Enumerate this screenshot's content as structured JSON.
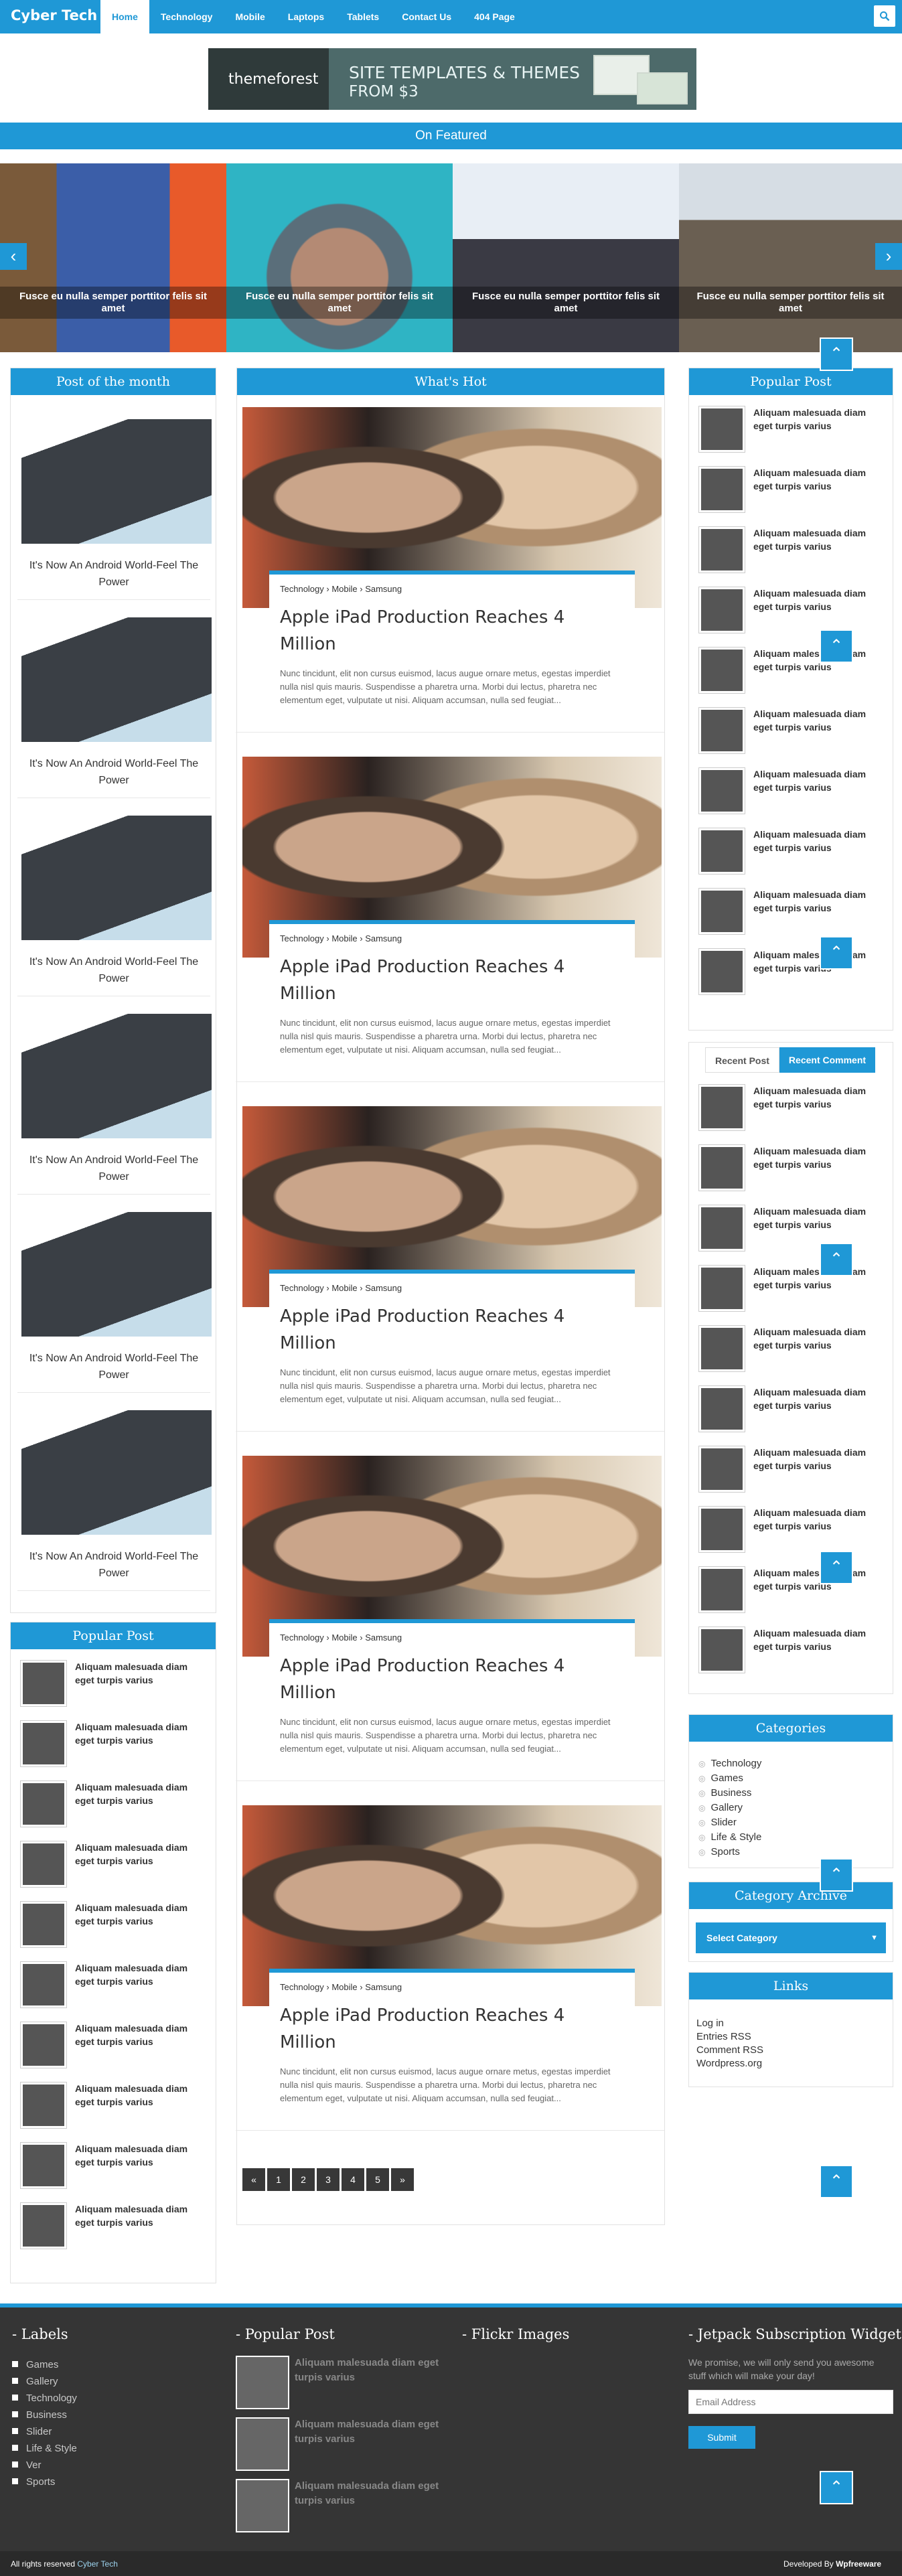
{
  "header": {
    "logo": "Cyber Tech",
    "nav": [
      "Home",
      "Technology",
      "Mobile",
      "Laptops",
      "Tablets",
      "Contact Us",
      "404 Page"
    ],
    "search_icon": "search-icon"
  },
  "banner": {
    "brand": "themeforest",
    "headline": "SITE TEMPLATES & THEMES",
    "subline": "FROM $3"
  },
  "featured": {
    "title": "On Featured",
    "slides": [
      "Fusce eu nulla semper porttitor felis sit amet",
      "Fusce eu nulla semper porttitor felis sit amet",
      "Fusce eu nulla semper porttitor felis sit amet",
      "Fusce eu nulla semper porttitor felis sit amet"
    ]
  },
  "left": {
    "potm_title": "Post of the month",
    "potm_items": [
      "It's Now An Android World-Feel The Power",
      "It's Now An Android World-Feel The Power",
      "It's Now An Android World-Feel The Power",
      "It's Now An Android World-Feel The Power",
      "It's Now An Android World-Feel The Power",
      "It's Now An Android World-Feel The Power"
    ],
    "popular_title": "Popular Post",
    "popular_items": [
      "Aliquam malesuada diam eget turpis varius",
      "Aliquam malesuada diam eget turpis varius",
      "Aliquam malesuada diam eget turpis varius",
      "Aliquam malesuada diam eget turpis varius",
      "Aliquam malesuada diam eget turpis varius",
      "Aliquam malesuada diam eget turpis varius",
      "Aliquam malesuada diam eget turpis varius",
      "Aliquam malesuada diam eget turpis varius",
      "Aliquam malesuada diam eget turpis varius",
      "Aliquam malesuada diam eget turpis varius"
    ]
  },
  "main": {
    "title": "What's Hot",
    "posts": [
      {
        "tags": [
          "Technology",
          "Mobile",
          "Samsung"
        ],
        "title": "Apple iPad Production Reaches 4 Million",
        "excerpt": "Nunc tincidunt, elit non cursus euismod, lacus augue ornare metus, egestas imperdiet nulla nisl quis mauris. Suspendisse a pharetra urna. Morbi dui lectus, pharetra nec elementum eget, vulputate ut nisi. Aliquam accumsan, nulla sed feugiat..."
      },
      {
        "tags": [
          "Technology",
          "Mobile",
          "Samsung"
        ],
        "title": "Apple iPad Production Reaches 4 Million",
        "excerpt": "Nunc tincidunt, elit non cursus euismod, lacus augue ornare metus, egestas imperdiet nulla nisl quis mauris. Suspendisse a pharetra urna. Morbi dui lectus, pharetra nec elementum eget, vulputate ut nisi. Aliquam accumsan, nulla sed feugiat..."
      },
      {
        "tags": [
          "Technology",
          "Mobile",
          "Samsung"
        ],
        "title": "Apple iPad Production Reaches 4 Million",
        "excerpt": "Nunc tincidunt, elit non cursus euismod, lacus augue ornare metus, egestas imperdiet nulla nisl quis mauris. Suspendisse a pharetra urna. Morbi dui lectus, pharetra nec elementum eget, vulputate ut nisi. Aliquam accumsan, nulla sed feugiat..."
      },
      {
        "tags": [
          "Technology",
          "Mobile",
          "Samsung"
        ],
        "title": "Apple iPad Production Reaches 4 Million",
        "excerpt": "Nunc tincidunt, elit non cursus euismod, lacus augue ornare metus, egestas imperdiet nulla nisl quis mauris. Suspendisse a pharetra urna. Morbi dui lectus, pharetra nec elementum eget, vulputate ut nisi. Aliquam accumsan, nulla sed feugiat..."
      },
      {
        "tags": [
          "Technology",
          "Mobile",
          "Samsung"
        ],
        "title": "Apple iPad Production Reaches 4 Million",
        "excerpt": "Nunc tincidunt, elit non cursus euismod, lacus augue ornare metus, egestas imperdiet nulla nisl quis mauris. Suspendisse a pharetra urna. Morbi dui lectus, pharetra nec elementum eget, vulputate ut nisi. Aliquam accumsan, nulla sed feugiat..."
      }
    ],
    "pager": [
      "«",
      "1",
      "2",
      "3",
      "4",
      "5",
      "»"
    ]
  },
  "right": {
    "popular_title": "Popular Post",
    "popular_items": [
      "Aliquam malesuada diam eget turpis varius",
      "Aliquam malesuada diam eget turpis varius",
      "Aliquam malesuada diam eget turpis varius",
      "Aliquam malesuada diam eget turpis varius",
      "Aliquam malesuada diam eget turpis varius",
      "Aliquam malesuada diam eget turpis varius",
      "Aliquam malesuada diam eget turpis varius",
      "Aliquam malesuada diam eget turpis varius",
      "Aliquam malesuada diam eget turpis varius",
      "Aliquam malesuada diam eget turpis varius"
    ],
    "tabs": [
      "Recent Post",
      "Recent Comment"
    ],
    "recent_items": [
      "Aliquam malesuada diam eget turpis varius",
      "Aliquam malesuada diam eget turpis varius",
      "Aliquam malesuada diam eget turpis varius",
      "Aliquam malesuada diam eget turpis varius",
      "Aliquam malesuada diam eget turpis varius",
      "Aliquam malesuada diam eget turpis varius",
      "Aliquam malesuada diam eget turpis varius",
      "Aliquam malesuada diam eget turpis varius",
      "Aliquam malesuada diam eget turpis varius",
      "Aliquam malesuada diam eget turpis varius"
    ],
    "categories_title": "Categories",
    "categories": [
      "Technology",
      "Games",
      "Business",
      "Gallery",
      "Slider",
      "Life & Style",
      "Sports"
    ],
    "archive_title": "Category Archive",
    "archive_select": "Select Category",
    "links_title": "Links",
    "links": [
      "Log in",
      "Entries RSS",
      "Comment RSS",
      "Wordpress.org"
    ]
  },
  "footer": {
    "labels_title": "Labels",
    "labels": [
      "Games",
      "Gallery",
      "Technology",
      "Business",
      "Slider",
      "Life & Style",
      "Ver",
      "Sports"
    ],
    "popular_title": "Popular Post",
    "popular_items": [
      "Aliquam malesuada diam eget turpis varius",
      "Aliquam malesuada diam eget turpis varius",
      "Aliquam malesuada diam eget turpis varius"
    ],
    "flickr_title": "Flickr Images",
    "jetpack_title": "Jetpack Subscription Widget",
    "jetpack_text": "We promise, we will only send you awesome stuff which will make your day!",
    "email_placeholder": "Email Address",
    "submit": "Submit",
    "copyright": "All rights reserved",
    "copyright_brand": "Cyber Tech",
    "developed_by": "Developed By",
    "developer": "Wpfreeware"
  },
  "colors": {
    "accent": "#1f98d6",
    "footer_bg": "#353535"
  }
}
